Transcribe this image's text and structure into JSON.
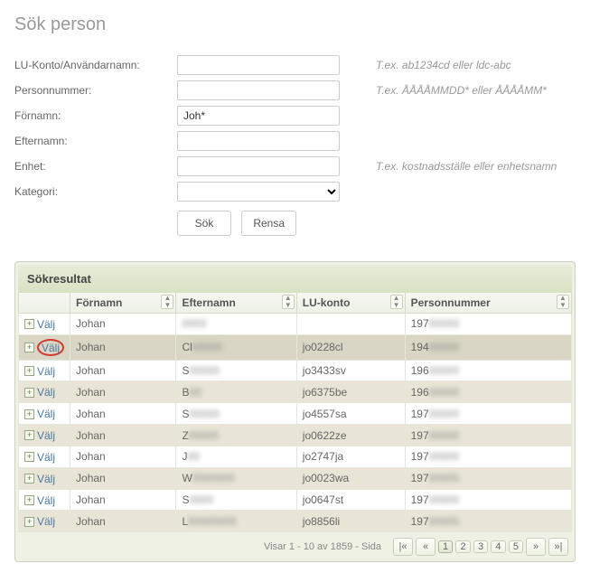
{
  "page_title": "Sök person",
  "form": {
    "fields": [
      {
        "label": "LU-Konto/Användarnamn:",
        "value": "",
        "hint": "T.ex. ab1234cd eller ldc-abc",
        "type": "text"
      },
      {
        "label": "Personnummer:",
        "value": "",
        "hint": "T.ex. ÅÅÅÅMMDD* eller ÅÅÅÅMM*",
        "type": "text"
      },
      {
        "label": "Förnamn:",
        "value": "Joh*",
        "hint": "",
        "type": "text"
      },
      {
        "label": "Efternamn:",
        "value": "",
        "hint": "",
        "type": "text"
      },
      {
        "label": "Enhet:",
        "value": "",
        "hint": "T.ex. kostnadsställe eller enhetsnamn",
        "type": "text"
      },
      {
        "label": "Kategori:",
        "value": "",
        "hint": "",
        "type": "select"
      }
    ],
    "search_label": "Sök",
    "reset_label": "Rensa"
  },
  "results": {
    "panel_title": "Sökresultat",
    "select_label": "Välj",
    "columns": [
      "Förnamn",
      "Efternamn",
      "LU-konto",
      "Personnummer"
    ],
    "rows": [
      {
        "fornamn": "Johan",
        "efternamn": "████",
        "lukonto": "",
        "pnr": "197█████",
        "highlight": false
      },
      {
        "fornamn": "Johan",
        "efternamn": "Cl█████",
        "lukonto": "jo0228cl",
        "pnr": "194█████",
        "highlight": true
      },
      {
        "fornamn": "Johan",
        "efternamn": "S█████",
        "lukonto": "jo3433sv",
        "pnr": "196█████",
        "highlight": false
      },
      {
        "fornamn": "Johan",
        "efternamn": "B██",
        "lukonto": "jo6375be",
        "pnr": "196█████",
        "highlight": false
      },
      {
        "fornamn": "Johan",
        "efternamn": "S█████",
        "lukonto": "jo4557sa",
        "pnr": "197█████",
        "highlight": false
      },
      {
        "fornamn": "Johan",
        "efternamn": "Z█████",
        "lukonto": "jo0622ze",
        "pnr": "197█████",
        "highlight": false
      },
      {
        "fornamn": "Johan",
        "efternamn": "J██",
        "lukonto": "jo2747ja",
        "pnr": "197█████",
        "highlight": false
      },
      {
        "fornamn": "Johan",
        "efternamn": "W███████",
        "lukonto": "jo0023wa",
        "pnr": "197█████",
        "highlight": false
      },
      {
        "fornamn": "Johan",
        "efternamn": "S████",
        "lukonto": "jo0647st",
        "pnr": "197█████",
        "highlight": false
      },
      {
        "fornamn": "Johan",
        "efternamn": "L████████",
        "lukonto": "jo8856li",
        "pnr": "197█████",
        "highlight": false
      }
    ],
    "pager": {
      "info": "Visar 1 - 10 av 1859 - Sida",
      "first": "|«",
      "prev": "«",
      "pages": [
        "1",
        "2",
        "3",
        "4",
        "5"
      ],
      "next": "»",
      "last": "»|",
      "active_index": 0
    }
  }
}
